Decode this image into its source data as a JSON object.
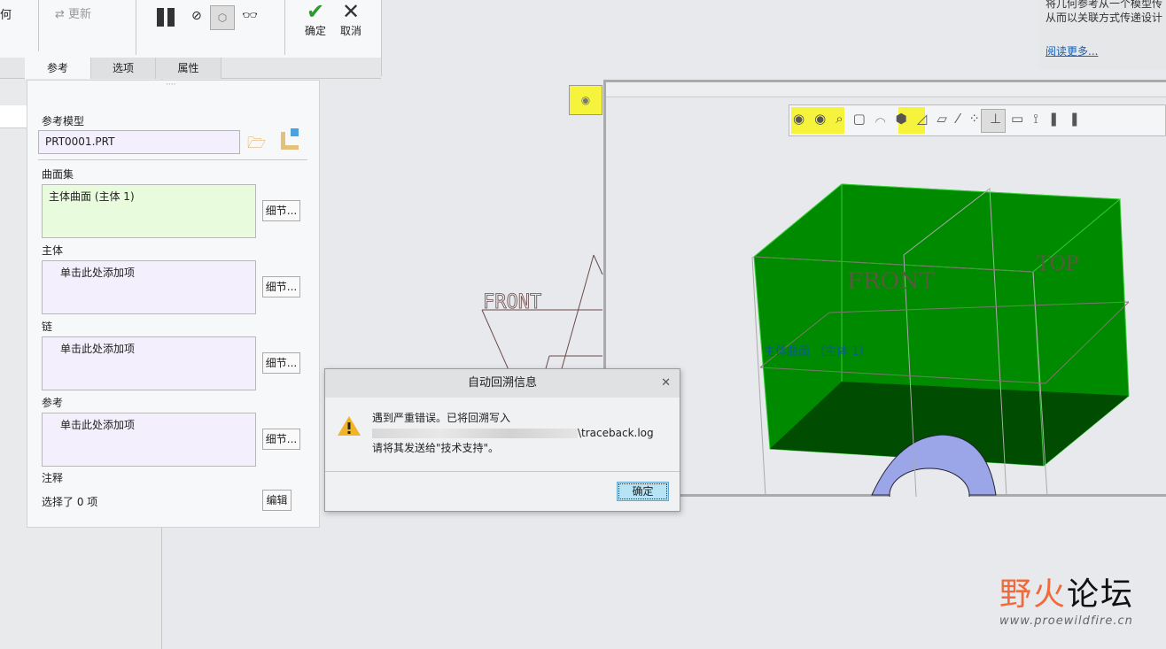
{
  "ribbon": {
    "partial_left_label": "何",
    "refresh_label": "更新",
    "confirm_label": "确定",
    "cancel_label": "取消",
    "icons": [
      "pause-icon",
      "no-preview-icon",
      "verify-icon",
      "glasses-icon"
    ]
  },
  "tabs": [
    {
      "label": "参考",
      "active": true
    },
    {
      "label": "选项"
    },
    {
      "label": "属性"
    }
  ],
  "help": {
    "line1": "将几何参考从一个模型传",
    "line2": "从而以关联方式传递设计",
    "link": "阅读更多..."
  },
  "panel": {
    "ref_model_label": "参考模型",
    "ref_model_value": "PRT0001.PRT",
    "surface_set_label": "曲面集",
    "surface_set_item": "主体曲面 (主体 1)",
    "body_label": "主体",
    "body_placeholder": "单击此处添加项",
    "chain_label": "链",
    "chain_placeholder": "单击此处添加项",
    "refs_label": "参考",
    "refs_placeholder": "单击此处添加项",
    "details_label": "细节...",
    "notes_label": "注释",
    "selected_text": "选择了 0 项",
    "edit_label": "编辑"
  },
  "graphics": {
    "datum_front": "FRONT"
  },
  "preview": {
    "datum_front": "FRONT",
    "datum_top": "TOP",
    "surface_label": "主体曲面 （主体 1）",
    "toolbar_icons": [
      "show-saved-view-icon",
      "show-view-history-icon",
      "zoom-icon",
      "display-style-icon",
      "show-datum-planes-icon",
      "appearance-icon",
      "section-icon",
      "plane-display-icon",
      "axis-display-icon",
      "point-display-icon",
      "csys-display-icon",
      "annotation-display-icon",
      "connector-icon",
      "pause-icon"
    ]
  },
  "dialog": {
    "title": "自动回溯信息",
    "line1": "遇到严重错误。已将回溯写入",
    "line2": "\\traceback.log",
    "line3": "请将其发送给\"技术支持\"。",
    "ok_label": "确定"
  },
  "watermark": {
    "brand": "野火论坛",
    "url": "www.proewildfire.cn"
  },
  "colors": {
    "surface_green": "#008000",
    "highlight_yellow": "#f5f33c",
    "ok_button": "#b6e4f7"
  }
}
